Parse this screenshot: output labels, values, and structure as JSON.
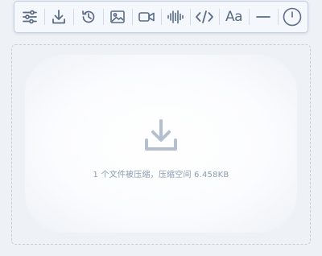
{
  "toolbar": {
    "buttons": [
      {
        "icon": "sliders-icon"
      },
      {
        "icon": "download-icon"
      },
      {
        "icon": "history-icon"
      },
      {
        "icon": "image-icon"
      },
      {
        "icon": "video-icon"
      },
      {
        "icon": "audio-waveform-icon"
      },
      {
        "icon": "code-icon"
      },
      {
        "icon": "font-icon",
        "label": "Aa"
      },
      {
        "icon": "minimize-icon"
      },
      {
        "icon": "power-icon"
      }
    ]
  },
  "dropzone": {
    "icon": "download-icon",
    "status_text": "1 个文件被压缩，压缩空间 6.458KB"
  },
  "colors": {
    "icon": "#5a6c86",
    "drop_icon": "#b5c0cf",
    "text_muted": "#8c9bb0",
    "background": "#eef2f7"
  }
}
